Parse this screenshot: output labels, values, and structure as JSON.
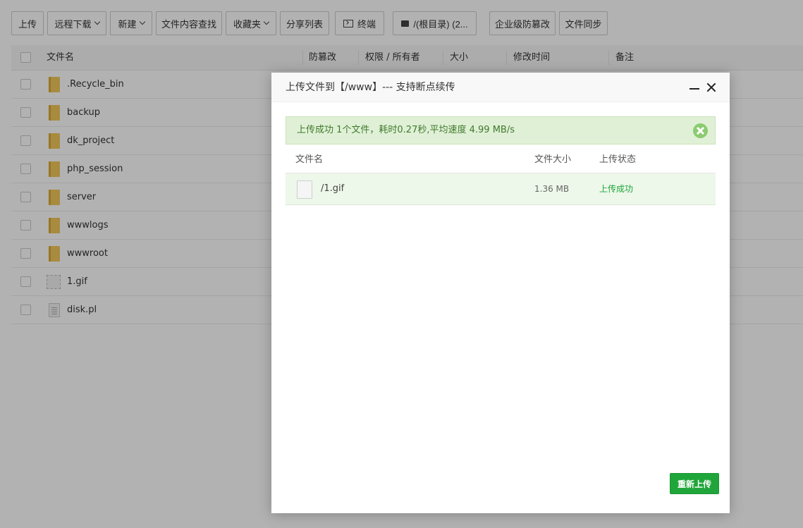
{
  "toolbar": {
    "upload": "上传",
    "remote_download": "远程下载",
    "new": "新建",
    "content_search": "文件内容查找",
    "favorites": "收藏夹",
    "share_list": "分享列表",
    "terminal": "终端",
    "root_dir": "/(根目录) (2...",
    "anti_tamper": "企业级防篡改",
    "file_sync": "文件同步"
  },
  "table": {
    "headers": {
      "name": "文件名",
      "tamper": "防篡改",
      "perm": "权限 / 所有者",
      "size": "大小",
      "mtime": "修改时间",
      "note": "备注"
    },
    "rows": [
      {
        "name": ".Recycle_bin",
        "icon": "folder-icon"
      },
      {
        "name": "backup",
        "icon": "folder-icon"
      },
      {
        "name": "dk_project",
        "icon": "folder-icon"
      },
      {
        "name": "php_session",
        "icon": "folder-icon"
      },
      {
        "name": "server",
        "icon": "folder-icon"
      },
      {
        "name": "wwwlogs",
        "icon": "folder-icon"
      },
      {
        "name": "wwwroot",
        "icon": "folder-icon"
      },
      {
        "name": "1.gif",
        "icon": "image-icon"
      },
      {
        "name": "disk.pl",
        "icon": "document-icon"
      }
    ]
  },
  "modal": {
    "title": "上传文件到【/www】--- 支持断点续传",
    "alert": "上传成功 1个文件，耗时0.27秒,平均速度 4.99 MB/s",
    "headers": {
      "name": "文件名",
      "size": "文件大小",
      "status": "上传状态"
    },
    "files": [
      {
        "name": "/1.gif",
        "size": "1.36 MB",
        "status": "上传成功"
      }
    ],
    "reupload_label": "重新上传"
  },
  "colors": {
    "success_green": "#20a53a",
    "alert_bg": "#e0f0d7",
    "folder": "#f1c85a"
  }
}
